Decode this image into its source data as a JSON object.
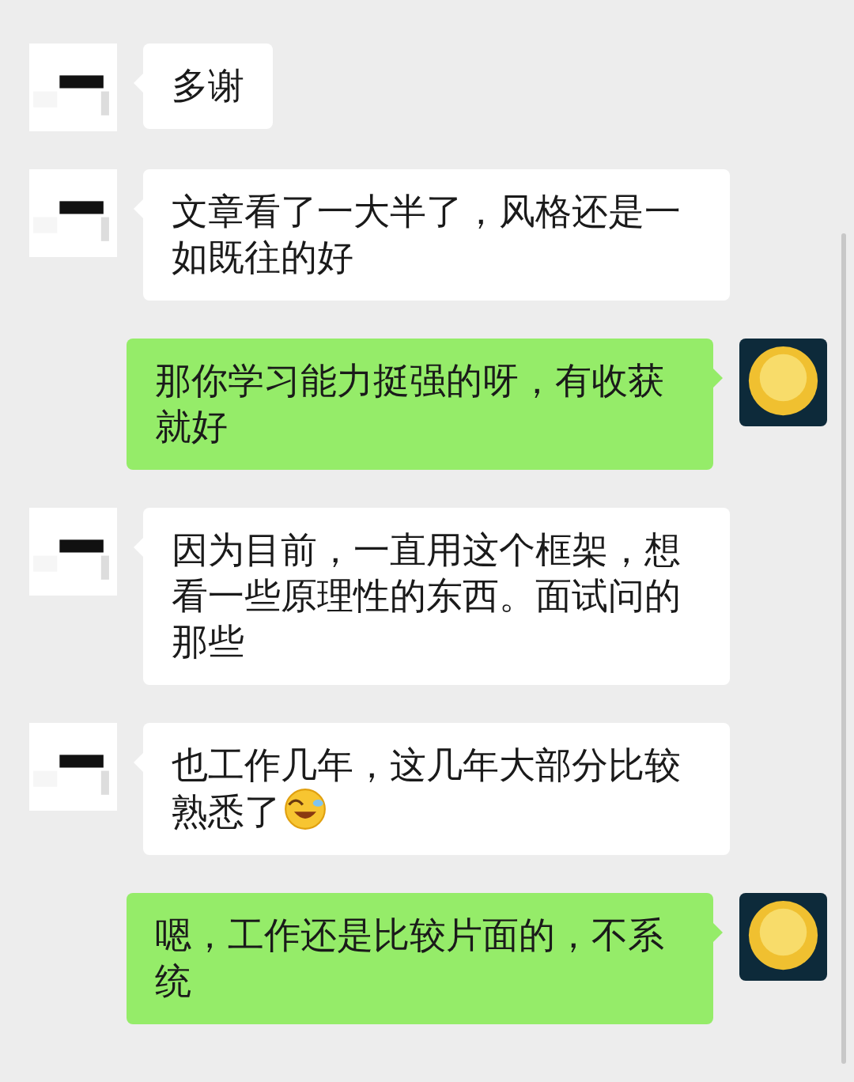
{
  "messages": [
    {
      "kind": "incoming",
      "text": "多谢",
      "emoji_after": false
    },
    {
      "kind": "incoming",
      "text": "文章看了一大半了，风格还是一如既往的好",
      "emoji_after": false
    },
    {
      "kind": "outgoing",
      "text": "那你学习能力挺强的呀，有收获就好",
      "emoji_after": false
    },
    {
      "kind": "incoming",
      "text": "因为目前，一直用这个框架，想看一些原理性的东西。面试问的那些",
      "emoji_after": false
    },
    {
      "kind": "incoming",
      "text": "也工作几年，这几年大部分比较熟悉了",
      "emoji_after": true
    },
    {
      "kind": "outgoing",
      "text": "嗯，工作还是比较片面的，不系统",
      "emoji_after": false
    }
  ]
}
